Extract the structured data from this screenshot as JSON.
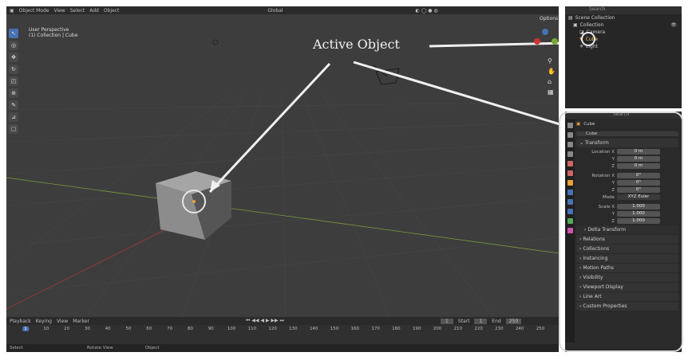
{
  "header": {
    "mode": "Object Mode",
    "menus": [
      "View",
      "Select",
      "Add",
      "Object"
    ],
    "transform_orientation": "Global",
    "options_label": "Options"
  },
  "viewport": {
    "perspective": "User Perspective",
    "collection_path": "(1) Collection | Cube"
  },
  "annotation": {
    "label": "Active Object"
  },
  "outliner": {
    "search_placeholder": "Search",
    "items": [
      {
        "label": "Scene Collection"
      },
      {
        "label": "Collection"
      },
      {
        "label": "Camera"
      },
      {
        "label": "Cube"
      },
      {
        "label": "Light"
      }
    ]
  },
  "properties": {
    "search_placeholder": "Search",
    "object_name": "Cube",
    "object_field": "Cube",
    "transform_header": "Transform",
    "location_label": "Location X",
    "location": [
      "0 m",
      "0 m",
      "0 m"
    ],
    "rotation_label": "Rotation X",
    "rotation": [
      "0°",
      "0°",
      "0°"
    ],
    "mode_label": "Mode",
    "mode_value": "XYZ Euler",
    "scale_label": "Scale X",
    "scale": [
      "1.000",
      "1.000",
      "1.000"
    ],
    "axis_y": "Y",
    "axis_z": "Z",
    "subpanels": [
      "Delta Transform",
      "Relations",
      "Collections",
      "Instancing",
      "Motion Paths",
      "Visibility",
      "Viewport Display",
      "Line Art",
      "Custom Properties"
    ]
  },
  "timeline": {
    "menus": [
      "Playback",
      "Keying",
      "View",
      "Marker"
    ],
    "current_frame": "1",
    "start_label": "Start",
    "start": "1",
    "end_label": "End",
    "end": "250",
    "ticks": [
      "1",
      "10",
      "20",
      "30",
      "40",
      "50",
      "60",
      "70",
      "80",
      "90",
      "100",
      "110",
      "120",
      "130",
      "140",
      "150",
      "160",
      "170",
      "180",
      "190",
      "200",
      "210",
      "220",
      "230",
      "240",
      "250"
    ]
  },
  "status": {
    "items": [
      "Select",
      "Rotate View",
      "Object"
    ]
  },
  "colors": {
    "accent": "#4772b3",
    "viewport_bg": "#3d3d3d",
    "active_highlight": "#e8a23a"
  }
}
